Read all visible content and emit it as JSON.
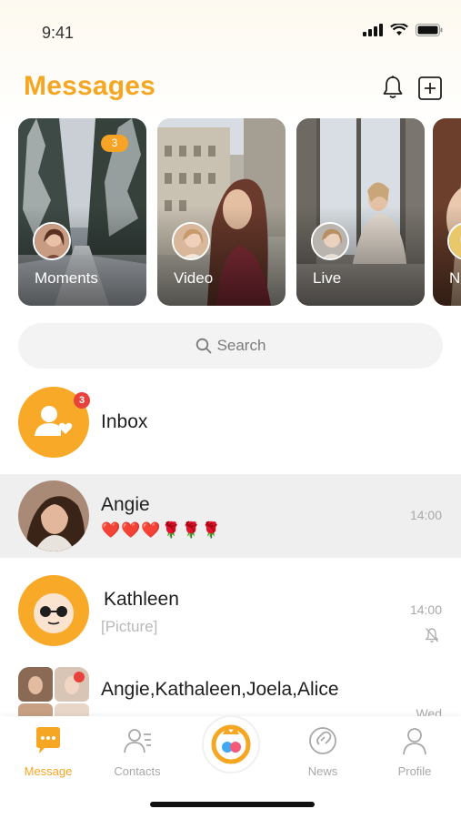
{
  "status_bar": {
    "time": "9:41"
  },
  "header": {
    "title": "Messages"
  },
  "stories": [
    {
      "label": "Moments",
      "badge": "3"
    },
    {
      "label": "Video"
    },
    {
      "label": "Live"
    },
    {
      "label": "Ne"
    }
  ],
  "search": {
    "label": "Search"
  },
  "inbox": {
    "label": "Inbox",
    "badge": "3"
  },
  "conversations": [
    {
      "name": "Angie",
      "preview": "❤️❤️❤️🌹🌹🌹",
      "time": "14:00"
    },
    {
      "name": "Kathleen",
      "preview": "[Picture]",
      "time": "14:00",
      "muted": true
    },
    {
      "name": "Angie,Kathaleen,Joela,Alice",
      "time": "Wed"
    }
  ],
  "tabbar": {
    "items": [
      {
        "label": "Message",
        "icon": "message-icon",
        "active": true
      },
      {
        "label": "Contacts",
        "icon": "contacts-icon"
      },
      {
        "label": "",
        "icon": "center-logo-icon"
      },
      {
        "label": "News",
        "icon": "news-icon"
      },
      {
        "label": "Profile",
        "icon": "profile-icon"
      }
    ]
  },
  "colors": {
    "accent": "#f5a623",
    "badge_red": "#e8433a",
    "selected_row": "#efefef"
  }
}
